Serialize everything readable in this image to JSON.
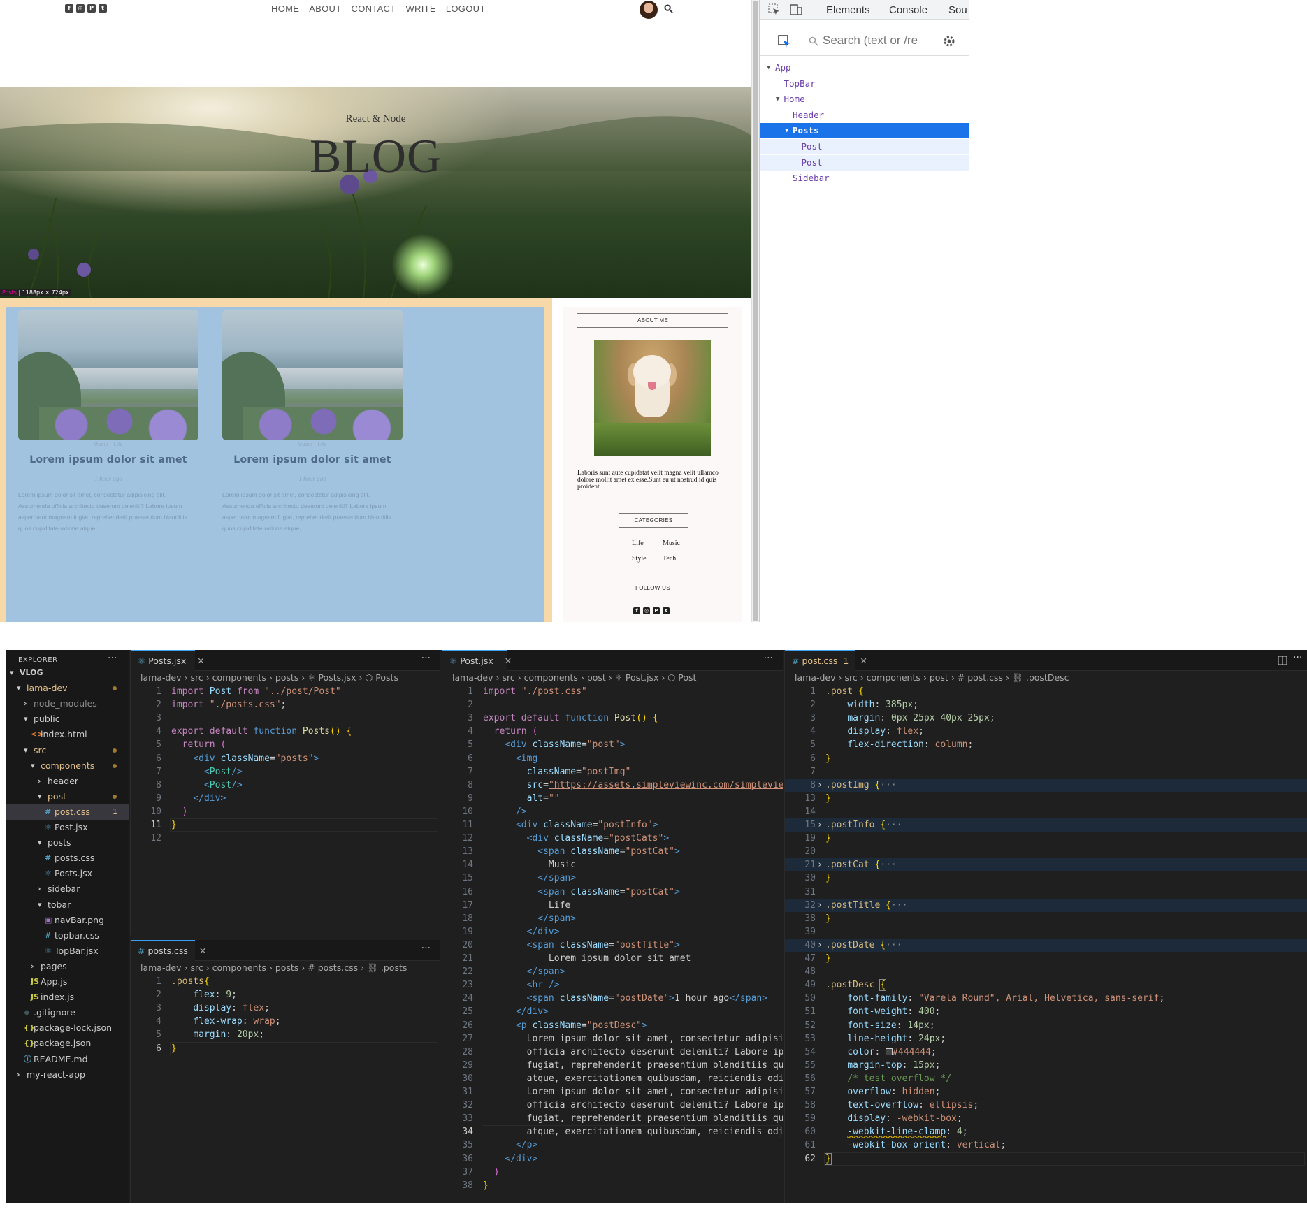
{
  "blog": {
    "nav": [
      "HOME",
      "ABOUT",
      "CONTACT",
      "WRITE",
      "LOGOUT"
    ],
    "social_icons": [
      "facebook-icon",
      "instagram-icon",
      "pinterest-icon",
      "twitter-icon"
    ],
    "hero": {
      "subtitle": "React & Node",
      "title": "BLOG"
    },
    "highlight_tag": {
      "name": "Posts",
      "size": "1188px × 724px"
    },
    "posts": [
      {
        "cats": [
          "Music",
          "Life"
        ],
        "title": "Lorem ipsum dolor sit amet",
        "date": "1 hour ago",
        "desc": "Lorem ipsum dolor sit amet, consectetur adipisicing elit. Assumenda officia architecto deserunt deleniti? Labore ipsum aspernatur magnam fugiat, reprehenderit praesentium blanditiis quos cupiditate ratione atque,..."
      },
      {
        "cats": [
          "Music",
          "Life"
        ],
        "title": "Lorem ipsum dolor sit amet",
        "date": "1 hour ago",
        "desc": "Lorem ipsum dolor sit amet, consectetur adipisicing elit. Assumenda officia architecto deserunt deleniti? Labore ipsum aspernatur magnam fugiat, reprehenderit praesentium blanditiis quos cupiditate ratione atque,..."
      }
    ],
    "sidebar": {
      "about_title": "ABOUT ME",
      "about_text": "Laboris sunt aute cupidatat velit magna velit ullamco dolore mollit amet ex esse.Sunt eu ut nostrud id quis proident.",
      "categories_title": "CATEGORIES",
      "categories": [
        "Life",
        "Music",
        "Style",
        "Tech"
      ],
      "follow_title": "FOLLOW US"
    }
  },
  "devtools": {
    "tabs": [
      "Elements",
      "Console",
      "Sou"
    ],
    "search_placeholder": "Search (text or /re",
    "tree": [
      {
        "label": "App",
        "depth": 0,
        "arrow": "▼",
        "state": ""
      },
      {
        "label": "TopBar",
        "depth": 1,
        "arrow": "",
        "state": ""
      },
      {
        "label": "Home",
        "depth": 1,
        "arrow": "▼",
        "state": ""
      },
      {
        "label": "Header",
        "depth": 2,
        "arrow": "",
        "state": ""
      },
      {
        "label": "Posts",
        "depth": 2,
        "arrow": "▼",
        "state": "selected"
      },
      {
        "label": "Post",
        "depth": 3,
        "arrow": "",
        "state": "child"
      },
      {
        "label": "Post",
        "depth": 3,
        "arrow": "",
        "state": "child"
      },
      {
        "label": "Sidebar",
        "depth": 2,
        "arrow": "",
        "state": ""
      }
    ]
  },
  "vscode": {
    "explorer": {
      "header": "EXPLORER",
      "more": "···",
      "items": [
        {
          "label": "VLOG",
          "depth": 0,
          "icon": "▾",
          "bold": true
        },
        {
          "label": "lama-dev",
          "depth": 1,
          "icon": "▾",
          "mod": true,
          "color": "#e2c08d"
        },
        {
          "label": "node_modules",
          "depth": 2,
          "icon": "›",
          "color": "#8b8b8b"
        },
        {
          "label": "public",
          "depth": 2,
          "icon": "▾"
        },
        {
          "label": "index.html",
          "depth": 3,
          "icon": "<>",
          "iconColor": "#e37933"
        },
        {
          "label": "src",
          "depth": 2,
          "icon": "▾",
          "mod": true,
          "color": "#e2c08d"
        },
        {
          "label": "components",
          "depth": 3,
          "icon": "▾",
          "mod": true,
          "color": "#e2c08d"
        },
        {
          "label": "header",
          "depth": 4,
          "icon": "›"
        },
        {
          "label": "post",
          "depth": 4,
          "icon": "▾",
          "mod": true,
          "color": "#e2c08d"
        },
        {
          "label": "post.css",
          "depth": 5,
          "icon": "#",
          "iconColor": "#519aba",
          "active": true,
          "badge": "1",
          "color": "#e2c08d"
        },
        {
          "label": "Post.jsx",
          "depth": 5,
          "icon": "⚛",
          "iconColor": "#519aba"
        },
        {
          "label": "posts",
          "depth": 4,
          "icon": "▾"
        },
        {
          "label": "posts.css",
          "depth": 5,
          "icon": "#",
          "iconColor": "#519aba"
        },
        {
          "label": "Posts.jsx",
          "depth": 5,
          "icon": "⚛",
          "iconColor": "#519aba"
        },
        {
          "label": "sidebar",
          "depth": 4,
          "icon": "›"
        },
        {
          "label": "tobar",
          "depth": 4,
          "icon": "▾"
        },
        {
          "label": "navBar.png",
          "depth": 5,
          "icon": "▣",
          "iconColor": "#a074c4"
        },
        {
          "label": "topbar.css",
          "depth": 5,
          "icon": "#",
          "iconColor": "#519aba"
        },
        {
          "label": "TopBar.jsx",
          "depth": 5,
          "icon": "⚛",
          "iconColor": "#519aba"
        },
        {
          "label": "pages",
          "depth": 3,
          "icon": "›"
        },
        {
          "label": "App.js",
          "depth": 3,
          "icon": "JS",
          "iconColor": "#cbcb41"
        },
        {
          "label": "index.js",
          "depth": 3,
          "icon": "JS",
          "iconColor": "#cbcb41"
        },
        {
          "label": ".gitignore",
          "depth": 2,
          "icon": "◆",
          "iconColor": "#41535b"
        },
        {
          "label": "package-lock.json",
          "depth": 2,
          "icon": "{}",
          "iconColor": "#cbcb41"
        },
        {
          "label": "package.json",
          "depth": 2,
          "icon": "{}",
          "iconColor": "#cbcb41"
        },
        {
          "label": "README.md",
          "depth": 2,
          "icon": "ⓘ",
          "iconColor": "#519aba"
        },
        {
          "label": "my-react-app",
          "depth": 1,
          "icon": "›"
        }
      ]
    },
    "panes": [
      {
        "id": "posts-jsx",
        "tab": "Posts.jsx",
        "tab_icon": "⚛",
        "crumb": "lama-dev  ›  src  ›  components  ›  posts  ›  ⚛ Posts.jsx  ›  ⬡ Posts",
        "current": 11,
        "lines": [
          "<span class=\"k\">import</span> <span class=\"a\">Post</span> <span class=\"k\">from</span> <span class=\"s\">\"../post/Post\"</span>",
          "<span class=\"k\">import</span> <span class=\"s\">\"./posts.css\"</span>;",
          "",
          "<span class=\"k\">export</span> <span class=\"k\">default</span> <span class=\"kw\">function</span> <span class=\"f\">Posts</span><span class=\"br\">()</span> <span class=\"br\">{</span>",
          "  <span class=\"k\">return</span> <span class=\"br2\">(</span>",
          "    <span class=\"t\">&lt;div</span> <span class=\"a\">className</span>=<span class=\"s\">\"posts\"</span><span class=\"t\">&gt;</span>",
          "      <span class=\"t\">&lt;</span><span class=\"cmp\">Post</span><span class=\"t\">/&gt;</span>",
          "      <span class=\"t\">&lt;</span><span class=\"cmp\">Post</span><span class=\"t\">/&gt;</span>",
          "    <span class=\"t\">&lt;/div&gt;</span>",
          "  <span class=\"br2\">)</span>",
          "<span class=\"br\">}</span>",
          ""
        ]
      },
      {
        "id": "posts-css",
        "tab": "posts.css",
        "tab_icon": "#",
        "crumb": "lama-dev  ›  src  ›  components  ›  posts  ›  # posts.css  ›  ⛓ .posts",
        "current": 6,
        "lines": [
          "<span class=\"sel\">.posts</span><span class=\"br\">{</span>",
          "    <span class=\"p\">flex</span>: <span class=\"n\">9</span>;",
          "    <span class=\"p\">display</span>: <span class=\"v\">flex</span>;",
          "    <span class=\"p\">flex-wrap</span>: <span class=\"v\">wrap</span>;",
          "    <span class=\"p\">margin</span>: <span class=\"n\">20px</span>;",
          "<span class=\"br\">}</span>"
        ]
      },
      {
        "id": "post-jsx",
        "tab": "Post.jsx",
        "tab_icon": "⚛",
        "crumb": "lama-dev  ›  src  ›  components  ›  post  ›  ⚛ Post.jsx  ›  ⬡ Post",
        "current": 34,
        "lines": [
          "<span class=\"k\">import</span> <span class=\"s\">\"./post.css\"</span>",
          "",
          "<span class=\"k\">export</span> <span class=\"k\">default</span> <span class=\"kw\">function</span> <span class=\"f\">Post</span><span class=\"br\">()</span> <span class=\"br\">{</span>",
          "  <span class=\"k\">return</span> <span class=\"br2\">(</span>",
          "    <span class=\"t\">&lt;div</span> <span class=\"a\">className</span>=<span class=\"s\">\"post\"</span><span class=\"t\">&gt;</span>",
          "      <span class=\"t\">&lt;img</span>",
          "        <span class=\"a\">className</span>=<span class=\"s\">\"postImg\"</span>",
          "        <span class=\"a\">src</span>=<span class=\"s\" style=\"text-decoration:underline\">\"https://assets.simpleviewinc.com/simpleview/image/uplo</span>",
          "        <span class=\"a\">alt</span>=<span class=\"s\">\"\"</span>",
          "      <span class=\"t\">/&gt;</span>",
          "      <span class=\"t\">&lt;div</span> <span class=\"a\">className</span>=<span class=\"s\">\"postInfo\"</span><span class=\"t\">&gt;</span>",
          "        <span class=\"t\">&lt;div</span> <span class=\"a\">className</span>=<span class=\"s\">\"postCats\"</span><span class=\"t\">&gt;</span>",
          "          <span class=\"t\">&lt;span</span> <span class=\"a\">className</span>=<span class=\"s\">\"postCat\"</span><span class=\"t\">&gt;</span>",
          "            Music",
          "          <span class=\"t\">&lt;/span&gt;</span>",
          "          <span class=\"t\">&lt;span</span> <span class=\"a\">className</span>=<span class=\"s\">\"postCat\"</span><span class=\"t\">&gt;</span>",
          "            Life",
          "          <span class=\"t\">&lt;/span&gt;</span>",
          "        <span class=\"t\">&lt;/div&gt;</span>",
          "        <span class=\"t\">&lt;span</span> <span class=\"a\">className</span>=<span class=\"s\">\"postTitle\"</span><span class=\"t\">&gt;</span>",
          "            Lorem ipsum dolor sit amet",
          "        <span class=\"t\">&lt;/span&gt;</span>",
          "        <span class=\"t\">&lt;hr /&gt;</span>",
          "        <span class=\"t\">&lt;span</span> <span class=\"a\">className</span>=<span class=\"s\">\"postDate\"</span><span class=\"t\">&gt;</span>1 hour ago<span class=\"t\">&lt;/span&gt;</span>",
          "      <span class=\"t\">&lt;/div&gt;</span>",
          "      <span class=\"t\">&lt;p</span> <span class=\"a\">className</span>=<span class=\"s\">\"postDesc\"</span><span class=\"t\">&gt;</span>",
          "        Lorem ipsum dolor sit amet, consectetur adipisicing elit. A",
          "        officia architecto deserunt deleniti? Labore ipsum aspernat",
          "        fugiat, reprehenderit praesentium blanditiis quos cupiditat",
          "        atque, exercitationem quibusdam, reiciendis odio laboriosam",
          "        Lorem ipsum dolor sit amet, consectetur adipisicing elit. A",
          "        officia architecto deserunt deleniti? Labore ipsum aspernat",
          "        fugiat, reprehenderit praesentium blanditiis quos cupiditat",
          "        atque, exercitationem quibusdam, reiciendis odio laboriosam",
          "      <span class=\"t\">&lt;/p&gt;</span>",
          "    <span class=\"t\">&lt;/div&gt;</span>",
          "  <span class=\"br2\">)</span>",
          "<span class=\"br\">}</span>"
        ]
      },
      {
        "id": "post-css",
        "tab": "post.css",
        "tab_icon": "#",
        "tab_badge": "1",
        "crumb": "lama-dev  ›  src  ›  components  ›  post  ›  # post.css  ›  ⛓ .postDesc",
        "current": 62,
        "line_numbers": [
          1,
          2,
          3,
          4,
          5,
          6,
          7,
          8,
          13,
          14,
          15,
          19,
          20,
          21,
          30,
          31,
          32,
          38,
          39,
          40,
          47,
          48,
          49,
          50,
          51,
          52,
          53,
          54,
          55,
          56,
          57,
          58,
          59,
          60,
          61,
          62
        ],
        "folded": [
          8,
          15,
          21,
          32,
          40
        ],
        "lines": [
          "<span class=\"sel\">.post</span> <span class=\"br\">{</span>",
          "    <span class=\"p\">width</span>: <span class=\"n\">385px</span>;",
          "    <span class=\"p\">margin</span>: <span class=\"n\">0px 25px 40px 25px</span>;",
          "    <span class=\"p\">display</span>: <span class=\"v\">flex</span>;",
          "    <span class=\"p\">flex-direction</span>: <span class=\"v\">column</span>;",
          "<span class=\"br\">}</span>",
          "",
          "<span class=\"sel\">.postImg</span> <span class=\"br\">{</span><span style=\"color:#888\">···</span>",
          "<span class=\"br\">}</span>",
          "",
          "<span class=\"sel\">.postInfo</span> <span class=\"br\">{</span><span style=\"color:#888\">···</span>",
          "<span class=\"br\">}</span>",
          "",
          "<span class=\"sel\">.postCat</span> <span class=\"br\">{</span><span style=\"color:#888\">···</span>",
          "<span class=\"br\">}</span>",
          "",
          "<span class=\"sel\">.postTitle</span> <span class=\"br\">{</span><span style=\"color:#888\">···</span>",
          "<span class=\"br\">}</span>",
          "",
          "<span class=\"sel\">.postDate</span> <span class=\"br\">{</span><span style=\"color:#888\">···</span>",
          "<span class=\"br\">}</span>",
          "",
          "<span class=\"sel\">.postDesc</span> <span class=\"br\" style=\"outline:1px solid #888\">{</span>",
          "    <span class=\"p\">font-family</span>: <span class=\"v\">\"Varela Round\", Arial, Helvetica, sans-serif</span>;",
          "    <span class=\"p\">font-weight</span>: <span class=\"n\">400</span>;",
          "    <span class=\"p\">font-size</span>: <span class=\"n\">14px</span>;",
          "    <span class=\"p\">line-height</span>: <span class=\"n\">24px</span>;",
          "    <span class=\"p\">color</span>: <span style=\"display:inline-block;width:10px;height:10px;border:1px solid #ccc;background:#444444;vertical-align:middle\"></span><span class=\"v\">#444444</span>;",
          "    <span class=\"p\">margin-top</span>: <span class=\"n\">15px</span>;",
          "    <span class=\"c\">/* test overflow */</span>",
          "    <span class=\"p\">overflow</span>: <span class=\"v\">hidden</span>;",
          "    <span class=\"p\">text-overflow</span>: <span class=\"v\">ellipsis</span>;",
          "    <span class=\"p\">display</span>: <span class=\"v\">-webkit-box</span>;",
          "    <span class=\"p\" style=\"text-decoration:underline wavy #cca700\">-webkit-line-clamp</span>: <span class=\"n\">4</span>;",
          "    <span class=\"p\">-webkit-box-orient</span>: <span class=\"v\">vertical</span>;",
          "<span class=\"br\" style=\"outline:1px solid #888\">}</span>"
        ]
      }
    ]
  }
}
